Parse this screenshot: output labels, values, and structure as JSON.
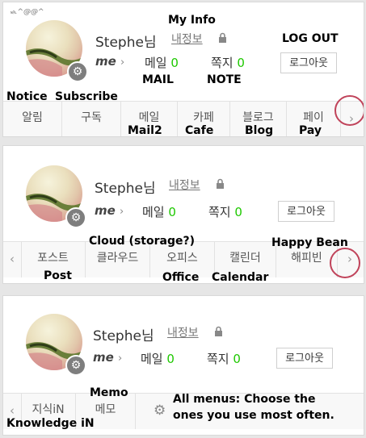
{
  "panels": [
    {
      "tiny_text": "ᏹ.^@@^",
      "username": "Stephe님",
      "info_link": "내정보",
      "me_label": "me",
      "me_arrow": "›",
      "mail_label": "메일",
      "mail_count": "0",
      "note_label": "쪽지",
      "note_count": "0",
      "logout": "로그아웃",
      "tabs": [
        "알림",
        "구독",
        "메일",
        "카페",
        "블로그",
        "페이"
      ],
      "next_arrow": "›",
      "annotations": {
        "my_info": "My Info",
        "log_out": "LOG OUT",
        "mail": "MAIL",
        "note": "NOTE",
        "notice": "Notice",
        "subscribe": "Subscribe",
        "mail2": "Mail2",
        "cafe": "Cafe",
        "blog": "Blog",
        "pay": "Pay"
      }
    },
    {
      "username": "Stephe님",
      "info_link": "내정보",
      "me_label": "me",
      "me_arrow": "›",
      "mail_label": "메일",
      "mail_count": "0",
      "note_label": "쪽지",
      "note_count": "0",
      "logout": "로그아웃",
      "prev_arrow": "‹",
      "tabs": [
        "포스트",
        "클라우드",
        "오피스",
        "캘린더",
        "해피빈"
      ],
      "next_arrow": "›",
      "annotations": {
        "cloud": "Cloud (storage?)",
        "happy_bean": "Happy Bean",
        "post": "Post",
        "office": "Office",
        "calendar": "Calendar"
      }
    },
    {
      "username": "Stephe님",
      "info_link": "내정보",
      "me_label": "me",
      "me_arrow": "›",
      "mail_label": "메일",
      "mail_count": "0",
      "note_label": "쪽지",
      "note_count": "0",
      "logout": "로그아웃",
      "prev_arrow": "‹",
      "tabs": [
        "지식iN",
        "메모"
      ],
      "annotations": {
        "memo": "Memo",
        "all_menus_1": "All menus: Choose the",
        "all_menus_2": "ones you use most often.",
        "knowledge": "Knowledge iN"
      }
    }
  ],
  "colors": {
    "count_green": "#1ec800",
    "circle": "#c0435a"
  },
  "icons": [
    "gear-icon",
    "lock-icon",
    "chevron-right-icon",
    "chevron-left-icon"
  ]
}
